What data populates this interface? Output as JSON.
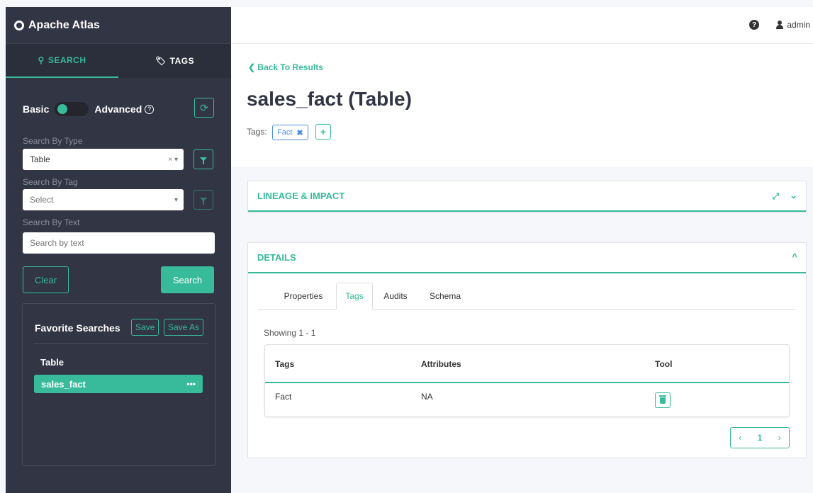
{
  "app": {
    "title": "Apache Atlas"
  },
  "sidebar": {
    "tabs": [
      {
        "label": "SEARCH",
        "icon": "search-icon",
        "active": true
      },
      {
        "label": "TAGS",
        "icon": "tag-icon",
        "active": false
      }
    ],
    "mode": {
      "basic_label": "Basic",
      "advanced_label": "Advanced",
      "help": "?"
    },
    "type": {
      "label": "Search By Type",
      "value": "Table",
      "clear": "×",
      "caret": "▾"
    },
    "tag": {
      "label": "Search By Tag",
      "placeholder": "Select",
      "caret": "▾"
    },
    "text": {
      "label": "Search By Text",
      "placeholder": "Search by text"
    },
    "clear_label": "Clear",
    "search_label": "Search",
    "favorites": {
      "title": "Favorite Searches",
      "save_label": "Save",
      "save_as_label": "Save As",
      "category": "Table",
      "items": [
        {
          "label": "sales_fact",
          "menu": "•••"
        }
      ]
    }
  },
  "header": {
    "help": "?",
    "user": "admin"
  },
  "entity": {
    "back_label": "Back To Results",
    "back_chevron": "❮",
    "title": "sales_fact (Table)",
    "tags_label": "Tags:",
    "tags": [
      {
        "label": "Fact",
        "remove": "✖"
      }
    ],
    "add_tag": "+"
  },
  "panels": {
    "lineage": {
      "title": "LINEAGE & IMPACT",
      "expand": "⤢",
      "chevron": "⌄"
    },
    "details": {
      "title": "DETAILS",
      "chevron": "^",
      "tabs": [
        {
          "label": "Properties",
          "active": false
        },
        {
          "label": "Tags",
          "active": true
        },
        {
          "label": "Audits",
          "active": false
        },
        {
          "label": "Schema",
          "active": false
        }
      ],
      "showing": "Showing 1 - 1",
      "columns": [
        "Tags",
        "Attributes",
        "Tool"
      ],
      "rows": [
        {
          "tag": "Fact",
          "attributes": "NA"
        }
      ],
      "pager": {
        "prev": "‹",
        "page": "1",
        "next": "›"
      }
    }
  },
  "colors": {
    "accent": "#37bb9b",
    "sidebar": "#323544",
    "tag": "#4a90e2"
  }
}
